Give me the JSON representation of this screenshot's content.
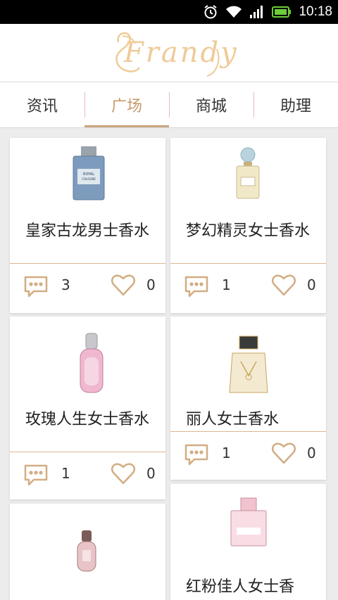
{
  "status_bar": {
    "time": "10:18"
  },
  "header": {
    "logo_text": "Frandy"
  },
  "tabs": [
    {
      "label": "资讯",
      "active": false
    },
    {
      "label": "广场",
      "active": true
    },
    {
      "label": "商城",
      "active": false
    },
    {
      "label": "助理",
      "active": false
    }
  ],
  "feed": {
    "items": [
      {
        "title": "皇家古龙男士香水",
        "comments": "3",
        "likes": "0"
      },
      {
        "title": "梦幻精灵女士香水",
        "comments": "1",
        "likes": "0"
      },
      {
        "title": "玫瑰人生女士香水",
        "comments": "1",
        "likes": "0"
      },
      {
        "title": "丽人女士香水",
        "comments": "1",
        "likes": "0"
      },
      {
        "title": "",
        "comments": "",
        "likes": ""
      },
      {
        "title": "红粉佳人女士香",
        "comments": "",
        "likes": ""
      }
    ]
  },
  "colors": {
    "accent": "#c59a6d",
    "logo": "#efcb97",
    "divider": "#d9b88f",
    "icon": "#d2ad83"
  }
}
